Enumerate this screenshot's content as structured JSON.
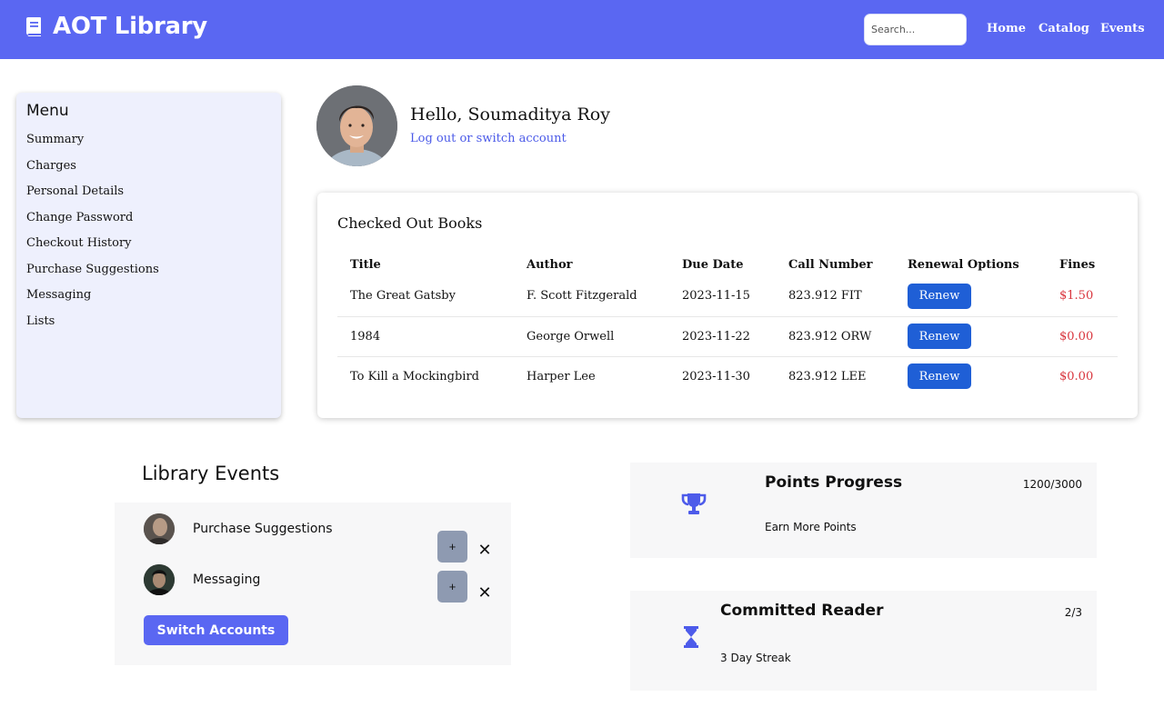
{
  "header": {
    "brand_icon": "book-icon",
    "title": "AOT Library",
    "search_placeholder": "Search...",
    "nav": [
      "Home",
      "Catalog",
      "Events"
    ],
    "color": "#5a67f2"
  },
  "sidebar": {
    "heading": "Menu",
    "items": [
      "Summary",
      "Charges",
      "Personal Details",
      "Change Password",
      "Checkout History",
      "Purchase Suggestions",
      "Messaging",
      "Lists"
    ]
  },
  "profile": {
    "greeting": "Hello, Soumaditya Roy",
    "logout_link": "Log out or switch account"
  },
  "checked_out": {
    "title": "Checked Out Books",
    "columns": [
      "Title",
      "Author",
      "Due Date",
      "Call Number",
      "Renewal Options",
      "Fines"
    ],
    "rows": [
      {
        "title": "The Great Gatsby",
        "author": "F. Scott Fitzgerald",
        "due": "2023-11-15",
        "call": "823.912 FIT",
        "action": "Renew",
        "fine": "$1.50"
      },
      {
        "title": "1984",
        "author": "George Orwell",
        "due": "2023-11-22",
        "call": "823.912 ORW",
        "action": "Renew",
        "fine": "$0.00"
      },
      {
        "title": "To Kill a Mockingbird",
        "author": "Harper Lee",
        "due": "2023-11-30",
        "call": "823.912 LEE",
        "action": "Renew",
        "fine": "$0.00"
      }
    ],
    "fine_color": "#d9363e"
  },
  "events": {
    "title": "Library Events",
    "items": [
      {
        "label": "Purchase Suggestions",
        "add": "+",
        "remove": "✕"
      },
      {
        "label": "Messaging",
        "add": "+",
        "remove": "✕"
      }
    ],
    "switch_button": "Switch Accounts"
  },
  "achievements": [
    {
      "icon": "trophy-icon",
      "title": "Points Progress",
      "subtitle": "Earn More Points",
      "value": "1200/3000"
    },
    {
      "icon": "hourglass-icon",
      "title": "Committed Reader",
      "subtitle": "3 Day Streak",
      "value": "2/3"
    }
  ]
}
